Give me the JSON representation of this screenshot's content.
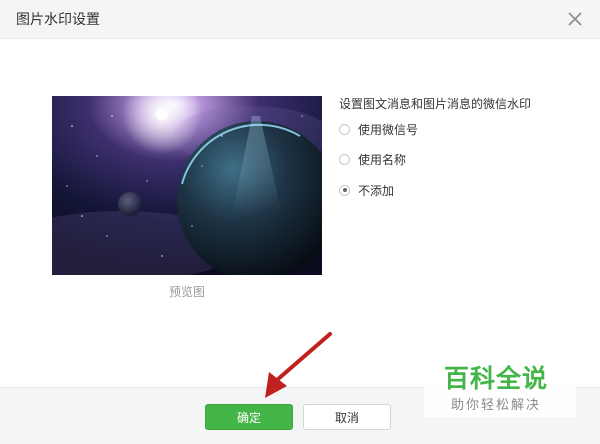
{
  "dialog": {
    "title": "图片水印设置",
    "close_icon": "close-icon"
  },
  "preview": {
    "image": "space-planet-image",
    "caption": "预览图"
  },
  "watermark_options": {
    "title": "设置图文消息和图片消息的微信水印",
    "items": [
      {
        "label": "使用微信号",
        "checked": false
      },
      {
        "label": "使用名称",
        "checked": false
      },
      {
        "label": "不添加",
        "checked": true
      }
    ]
  },
  "footer": {
    "confirm_label": "确定",
    "cancel_label": "取消"
  },
  "overlay": {
    "arrow_icon": "red-arrow-icon",
    "watermark_logo": "百科全说",
    "watermark_slogan": "助你轻松解决"
  },
  "colors": {
    "accent_green": "#44b549",
    "arrow_red": "#c0201f",
    "header_bg": "#f5f5f5"
  }
}
